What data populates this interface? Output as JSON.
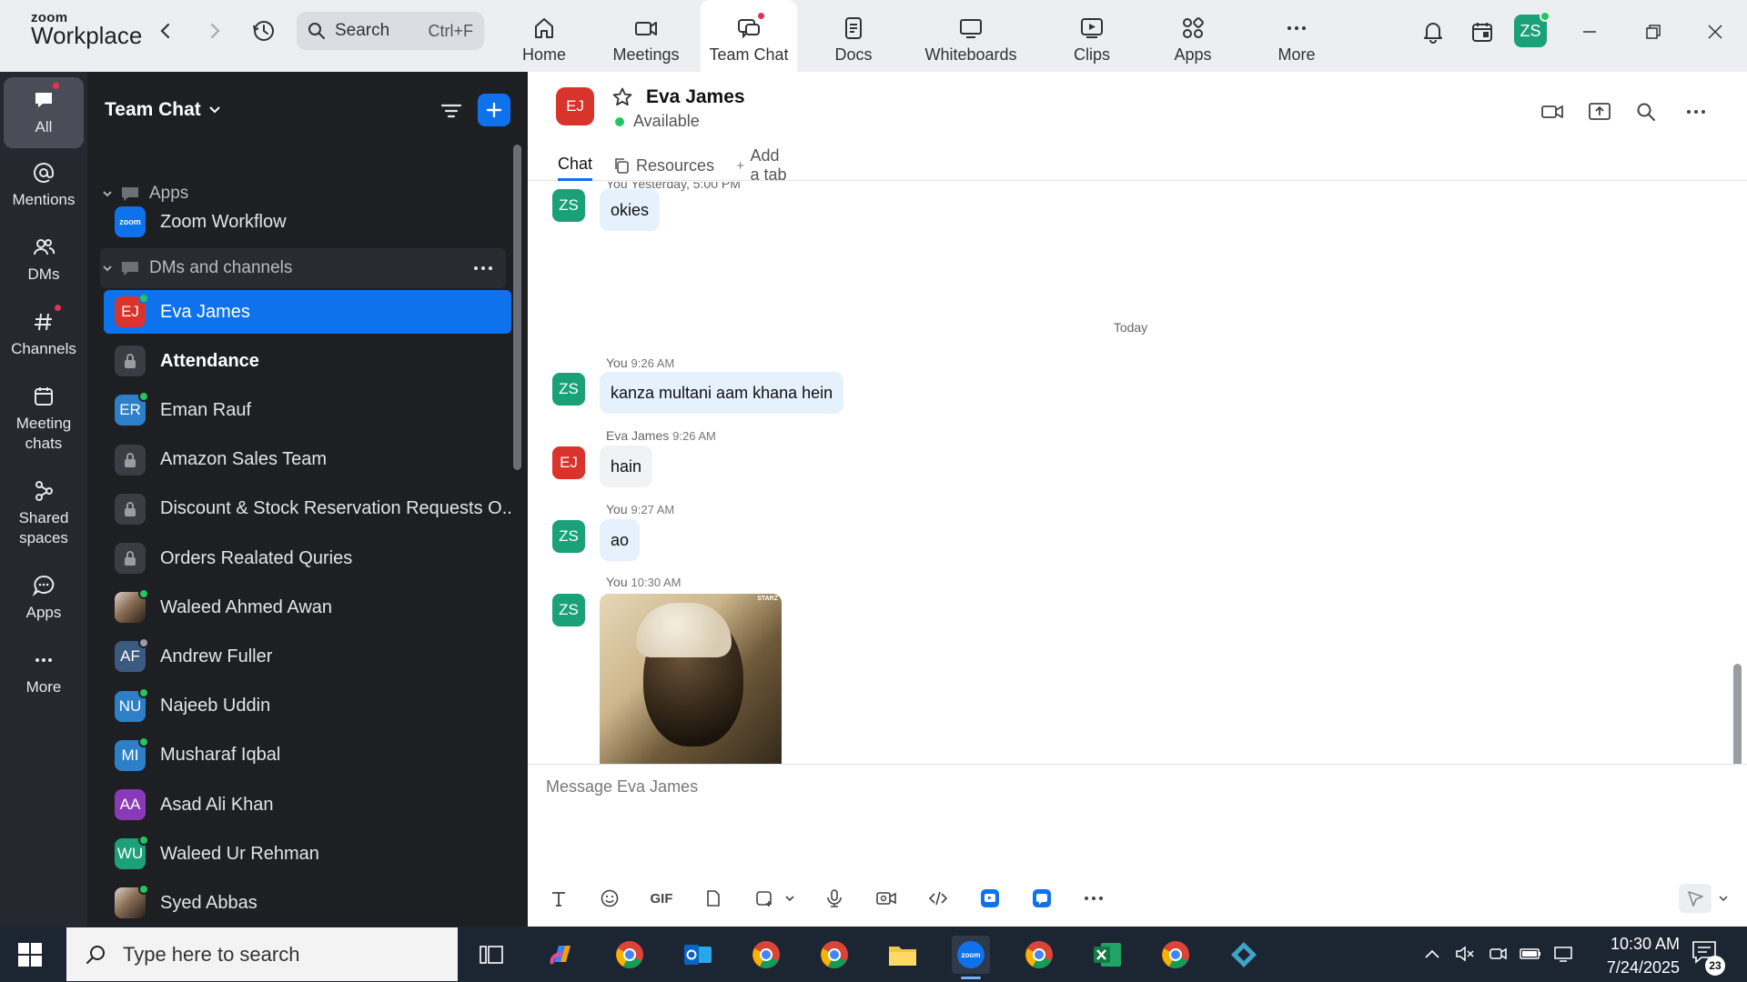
{
  "app": {
    "logo_line1": "zoom",
    "logo_line2": "Workplace",
    "search_label": "Search",
    "search_shortcut": "Ctrl+F",
    "nav": [
      {
        "label": "Home",
        "icon": "home-icon"
      },
      {
        "label": "Meetings",
        "icon": "video-icon"
      },
      {
        "label": "Team Chat",
        "icon": "chat-icon",
        "active": true
      },
      {
        "label": "Docs",
        "icon": "doc-icon"
      },
      {
        "label": "Whiteboards",
        "icon": "whiteboard-icon"
      },
      {
        "label": "Clips",
        "icon": "clips-icon"
      },
      {
        "label": "Apps",
        "icon": "apps-icon"
      },
      {
        "label": "More",
        "icon": "more-icon"
      }
    ],
    "user_initials": "ZS"
  },
  "rail": [
    {
      "label": "All",
      "icon": "chat-bubble-icon"
    },
    {
      "label": "Mentions",
      "icon": "at-icon"
    },
    {
      "label": "DMs",
      "icon": "people-icon"
    },
    {
      "label": "Channels",
      "icon": "hash-icon"
    },
    {
      "label": "Meeting chats",
      "icon": "calendar-icon"
    },
    {
      "label": "Shared spaces",
      "icon": "shared-spaces-icon"
    },
    {
      "label": "Apps",
      "icon": "apps-bubble-icon"
    },
    {
      "label": "More",
      "icon": "more-icon"
    }
  ],
  "sidebar": {
    "title": "Team Chat",
    "section_apps": "Apps",
    "section_dms": "DMs and channels",
    "apps": [
      {
        "name": "Zoom Workflow",
        "badge": "zoom"
      }
    ],
    "items": [
      {
        "name": "Eva James",
        "initials": "EJ",
        "color": "#d8342c",
        "type": "dm",
        "status": "online",
        "selected": true
      },
      {
        "name": "Attendance",
        "type": "channel",
        "bold": true
      },
      {
        "name": "Eman Rauf",
        "initials": "ER",
        "color": "#2d7fc8",
        "type": "dm",
        "status": "online"
      },
      {
        "name": "Amazon Sales Team",
        "type": "channel"
      },
      {
        "name": "Discount & Stock Reservation Requests O...",
        "type": "channel"
      },
      {
        "name": "Orders Realated Quries",
        "type": "channel"
      },
      {
        "name": "Waleed Ahmed Awan",
        "initials": "",
        "color": "#555",
        "type": "dm",
        "status": "online",
        "photo": true
      },
      {
        "name": "Andrew Fuller",
        "initials": "AF",
        "color": "#3a5a80",
        "type": "dm",
        "status": "away"
      },
      {
        "name": "Najeeb Uddin",
        "initials": "NU",
        "color": "#2d7fc8",
        "type": "dm",
        "status": "online"
      },
      {
        "name": "Musharaf Iqbal",
        "initials": "MI",
        "color": "#2d7fc8",
        "type": "dm",
        "status": "online"
      },
      {
        "name": "Asad Ali Khan",
        "initials": "AA",
        "color": "#8a3ab8",
        "type": "dm"
      },
      {
        "name": "Waleed Ur Rehman",
        "initials": "WU",
        "color": "#1aa178",
        "type": "dm",
        "status": "online"
      },
      {
        "name": "Syed Abbas",
        "initials": "",
        "color": "#444",
        "type": "dm",
        "status": "online",
        "photo": true
      }
    ]
  },
  "chat": {
    "contact_initials": "EJ",
    "contact_name": "Eva James",
    "contact_status": "Available",
    "tabs": {
      "chat": "Chat",
      "resources": "Resources",
      "add": "Add a tab"
    },
    "prev_meta": "You Yesterday, 5:00 PM",
    "prev_msg": "okies",
    "day_divider": "Today",
    "messages": [
      {
        "sender": "You",
        "time": "9:26 AM",
        "text": "kanza multani aam khana hein",
        "initials": "ZS",
        "mine": true
      },
      {
        "sender": "Eva James",
        "time": "9:26 AM",
        "text": "hain",
        "initials": "EJ",
        "mine": false
      },
      {
        "sender": "You",
        "time": "9:27 AM",
        "text": "ao",
        "initials": "ZS",
        "mine": true
      },
      {
        "sender": "You",
        "time": "10:30 AM",
        "text": "",
        "initials": "ZS",
        "mine": true,
        "image": true
      }
    ],
    "image_watermark": "STARZ",
    "composer_placeholder": "Message Eva James",
    "toolbar_gif": "GIF"
  },
  "taskbar": {
    "search_placeholder": "Type here to search",
    "time": "10:30 AM",
    "date": "7/24/2025",
    "notifications": "23"
  }
}
